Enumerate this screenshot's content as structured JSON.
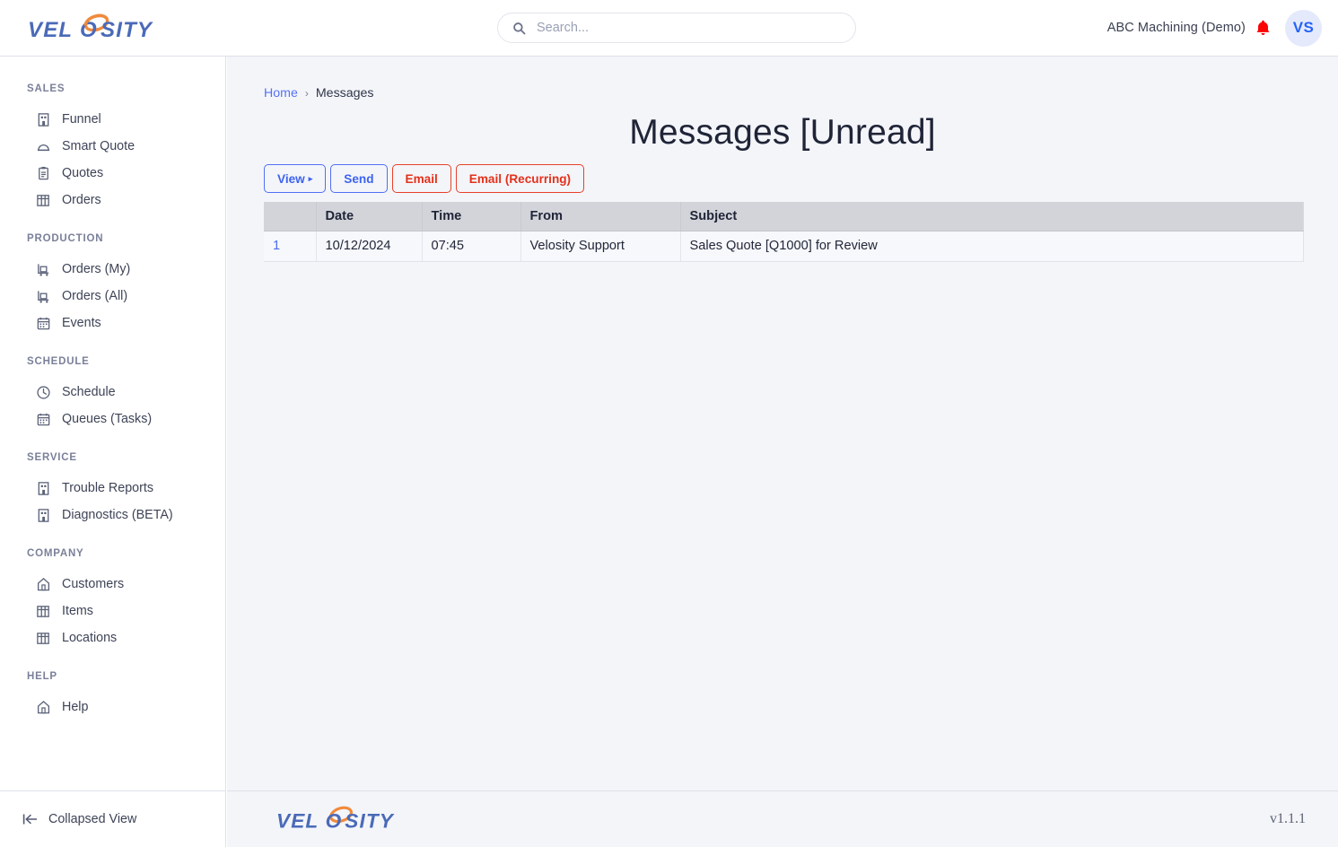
{
  "brand": {
    "name": "VELOSITY",
    "text_color": "#4a6ab8",
    "accent_color": "#f08a3c"
  },
  "header": {
    "search": {
      "value": "",
      "placeholder": "Search...",
      "icon": "search-icon"
    },
    "account_name": "ABC Machining (Demo)",
    "notification_icon": "bell-icon",
    "notification_color": "#fb0404",
    "avatar_initials": "VS",
    "avatar_bg": "#e4eafc",
    "avatar_fg": "#2563f6"
  },
  "sidebar": {
    "groups": [
      {
        "label": "SALES",
        "items": [
          {
            "label": "Funnel",
            "icon": "funnel-report-icon"
          },
          {
            "label": "Smart Quote",
            "icon": "smart-quote-icon"
          },
          {
            "label": "Quotes",
            "icon": "clipboard-icon"
          },
          {
            "label": "Orders",
            "icon": "table-icon"
          }
        ]
      },
      {
        "label": "PRODUCTION",
        "items": [
          {
            "label": "Orders (My)",
            "icon": "trolley-icon"
          },
          {
            "label": "Orders (All)",
            "icon": "trolley-icon"
          },
          {
            "label": "Events",
            "icon": "calendar-icon"
          }
        ]
      },
      {
        "label": "SCHEDULE",
        "items": [
          {
            "label": "Schedule",
            "icon": "clock-icon"
          },
          {
            "label": "Queues (Tasks)",
            "icon": "calendar-icon"
          }
        ]
      },
      {
        "label": "SERVICE",
        "items": [
          {
            "label": "Trouble Reports",
            "icon": "report-icon"
          },
          {
            "label": "Diagnostics (BETA)",
            "icon": "report-icon"
          }
        ]
      },
      {
        "label": "COMPANY",
        "items": [
          {
            "label": "Customers",
            "icon": "home-icon"
          },
          {
            "label": "Items",
            "icon": "table-icon"
          },
          {
            "label": "Locations",
            "icon": "table-icon"
          }
        ]
      },
      {
        "label": "HELP",
        "items": [
          {
            "label": "Help",
            "icon": "home-icon"
          }
        ]
      }
    ],
    "collapse": {
      "label": "Collapsed View",
      "icon": "collapse-left-icon"
    }
  },
  "main": {
    "breadcrumb": {
      "home": "Home",
      "separator": "›",
      "current": "Messages"
    },
    "title": "Messages [Unread]",
    "buttons": [
      {
        "label": "View",
        "style": "blue",
        "caret": "▸"
      },
      {
        "label": "Send",
        "style": "blue",
        "caret": ""
      },
      {
        "label": "Email",
        "style": "red",
        "caret": ""
      },
      {
        "label": "Email (Recurring)",
        "style": "red",
        "caret": ""
      }
    ],
    "table": {
      "columns": [
        "",
        "Date",
        "Time",
        "From",
        "Subject"
      ],
      "rows": [
        {
          "index": "1",
          "date": "10/12/2024",
          "time": "07:45",
          "from": "Velosity Support",
          "subject": "Sales Quote [Q1000] for Review"
        }
      ]
    }
  },
  "footer": {
    "version": "v1.1.1"
  }
}
